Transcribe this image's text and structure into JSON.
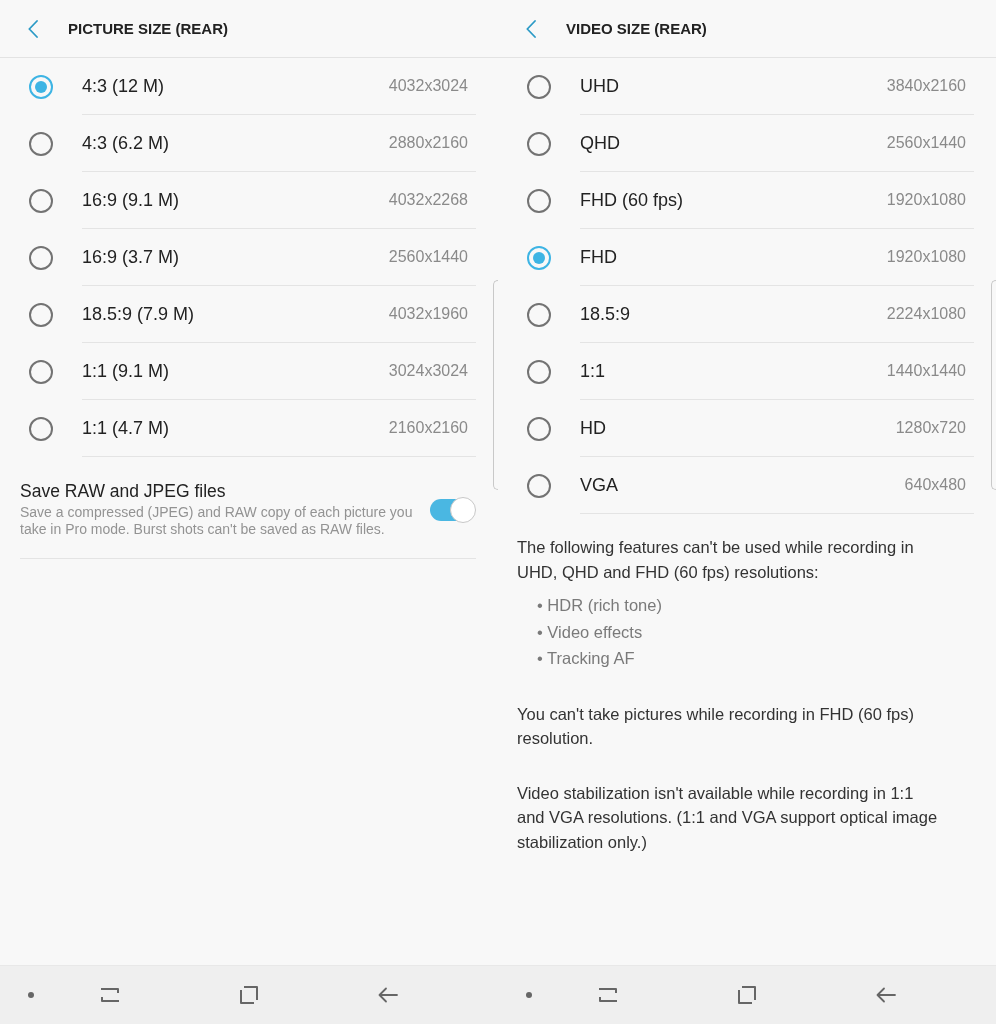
{
  "screens": [
    {
      "header": {
        "title": "PICTURE SIZE (REAR)"
      },
      "options": [
        {
          "label": "4:3 (12 M)",
          "resolution": "4032x3024",
          "selected": true
        },
        {
          "label": "4:3 (6.2 M)",
          "resolution": "2880x2160",
          "selected": false
        },
        {
          "label": "16:9 (9.1 M)",
          "resolution": "4032x2268",
          "selected": false
        },
        {
          "label": "16:9 (3.7 M)",
          "resolution": "2560x1440",
          "selected": false
        },
        {
          "label": "18.5:9 (7.9 M)",
          "resolution": "4032x1960",
          "selected": false
        },
        {
          "label": "1:1 (9.1 M)",
          "resolution": "3024x3024",
          "selected": false
        },
        {
          "label": "1:1 (4.7 M)",
          "resolution": "2160x2160",
          "selected": false
        }
      ],
      "details": [
        {
          "kind": "switch",
          "title": "Save RAW and JPEG files",
          "description": "Save a compressed (JPEG) and RAW copy of each picture you take in Pro mode. Burst shots can't be saved as RAW files.",
          "on": true
        }
      ]
    },
    {
      "header": {
        "title": "VIDEO SIZE (REAR)"
      },
      "options": [
        {
          "label": "UHD",
          "resolution": "3840x2160",
          "selected": false
        },
        {
          "label": "QHD",
          "resolution": "2560x1440",
          "selected": false
        },
        {
          "label": "FHD (60 fps)",
          "resolution": "1920x1080",
          "selected": false
        },
        {
          "label": "FHD",
          "resolution": "1920x1080",
          "selected": true
        },
        {
          "label": "18.5:9",
          "resolution": "2224x1080",
          "selected": false
        },
        {
          "label": "1:1",
          "resolution": "1440x1440",
          "selected": false
        },
        {
          "label": "HD",
          "resolution": "1280x720",
          "selected": false
        },
        {
          "label": "VGA",
          "resolution": "640x480",
          "selected": false
        }
      ],
      "details": [
        {
          "kind": "paragraph",
          "text": "The following features can't be used while recording in UHD, QHD and FHD (60 fps) resolutions:"
        },
        {
          "kind": "bullets",
          "items": [
            "• HDR (rich tone)",
            "• Video effects",
            "• Tracking AF"
          ]
        },
        {
          "kind": "paragraph",
          "text": "You can't take pictures while recording in FHD (60 fps) resolution."
        },
        {
          "kind": "paragraph",
          "text": "Video stabilization isn't available while recording in 1:1 and VGA resolutions. (1:1 and VGA support optical image stabilization only.)"
        }
      ]
    }
  ]
}
